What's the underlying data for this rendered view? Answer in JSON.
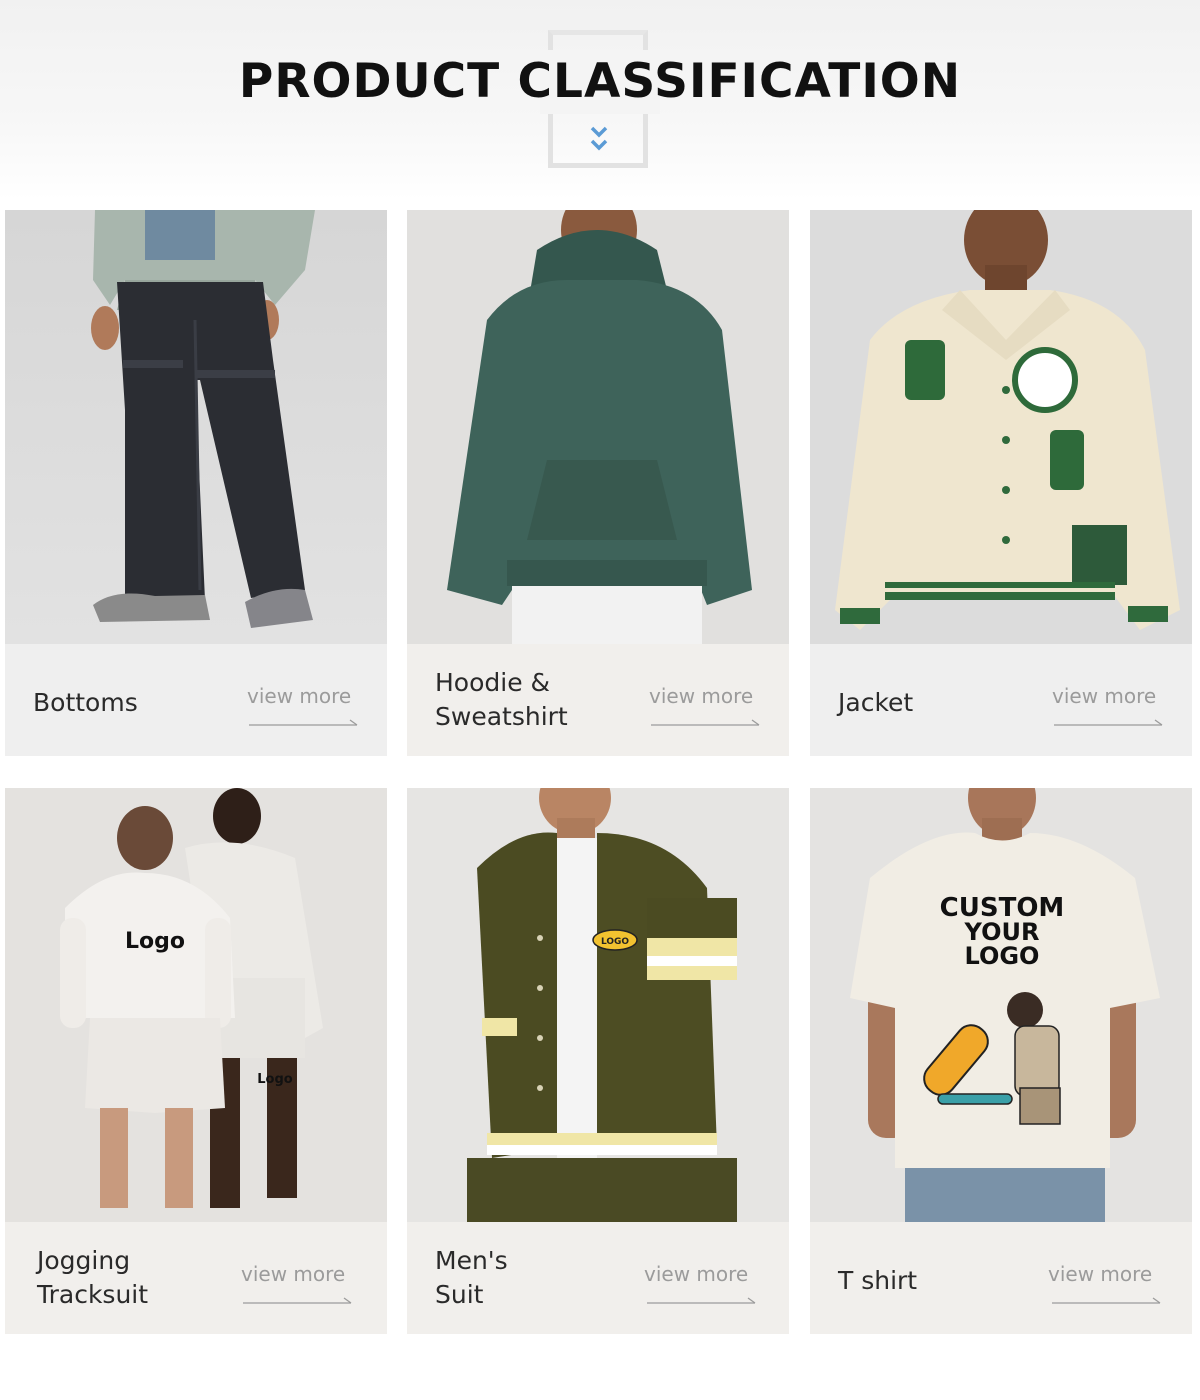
{
  "header": {
    "title": "PRODUCT CLASSIFICATION",
    "icon": "double-chevron-down-icon",
    "accent": "#5b9bd5"
  },
  "categories": [
    {
      "name": "Bottoms",
      "link": "view more"
    },
    {
      "name": "Hoodie &\nSweatshirt",
      "link": "view more"
    },
    {
      "name": "Jacket",
      "link": "view more"
    },
    {
      "name": "Jogging\nTracksuit",
      "link": "view more"
    },
    {
      "name": "Men's\nSuit",
      "link": "view more"
    },
    {
      "name": "T shirt",
      "link": "view more"
    }
  ],
  "prints": {
    "sweat_logo": "Logo",
    "shorts_logo": "Logo",
    "suit_badge": "LOGO",
    "tee_line1": "CUSTOM",
    "tee_line2": "YOUR",
    "tee_line3": "LOGO"
  }
}
